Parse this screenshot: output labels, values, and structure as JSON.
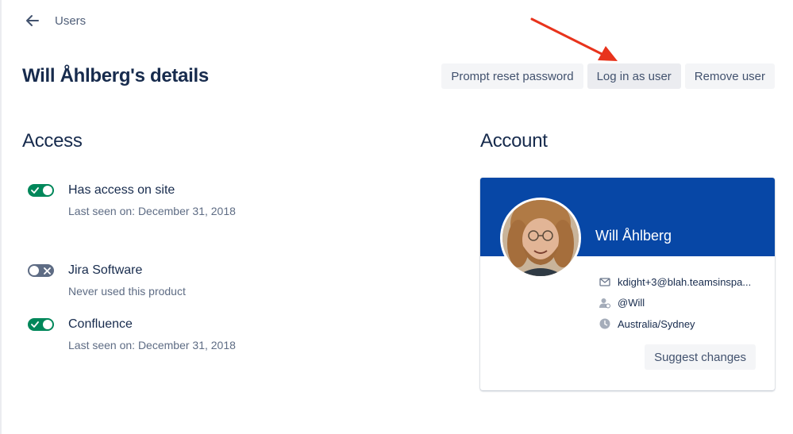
{
  "breadcrumb": {
    "label": "Users",
    "back_icon": "arrow-left-icon"
  },
  "page_title": "Will Åhlberg's details",
  "actions": {
    "prompt_reset": "Prompt reset password",
    "login_as": "Log in as user",
    "remove": "Remove user"
  },
  "annotation": {
    "color": "#e8331c"
  },
  "access": {
    "title": "Access",
    "items": [
      {
        "name": "Has access on site",
        "status": "Last seen on: December 31, 2018",
        "enabled": true
      },
      {
        "name": "Jira Software",
        "status": "Never used this product",
        "enabled": false
      },
      {
        "name": "Confluence",
        "status": "Last seen on: December 31, 2018",
        "enabled": true
      }
    ]
  },
  "account": {
    "title": "Account",
    "name": "Will Åhlberg",
    "email": "kdight+3@blah.teamsinspa...",
    "username": "@Will",
    "timezone": "Australia/Sydney",
    "suggest_label": "Suggest changes",
    "banner_color": "#0747a6"
  },
  "colors": {
    "toggle_on": "#00875a",
    "toggle_off": "#5e6c84",
    "text": "#172b4d",
    "muted": "#5e6c84"
  }
}
